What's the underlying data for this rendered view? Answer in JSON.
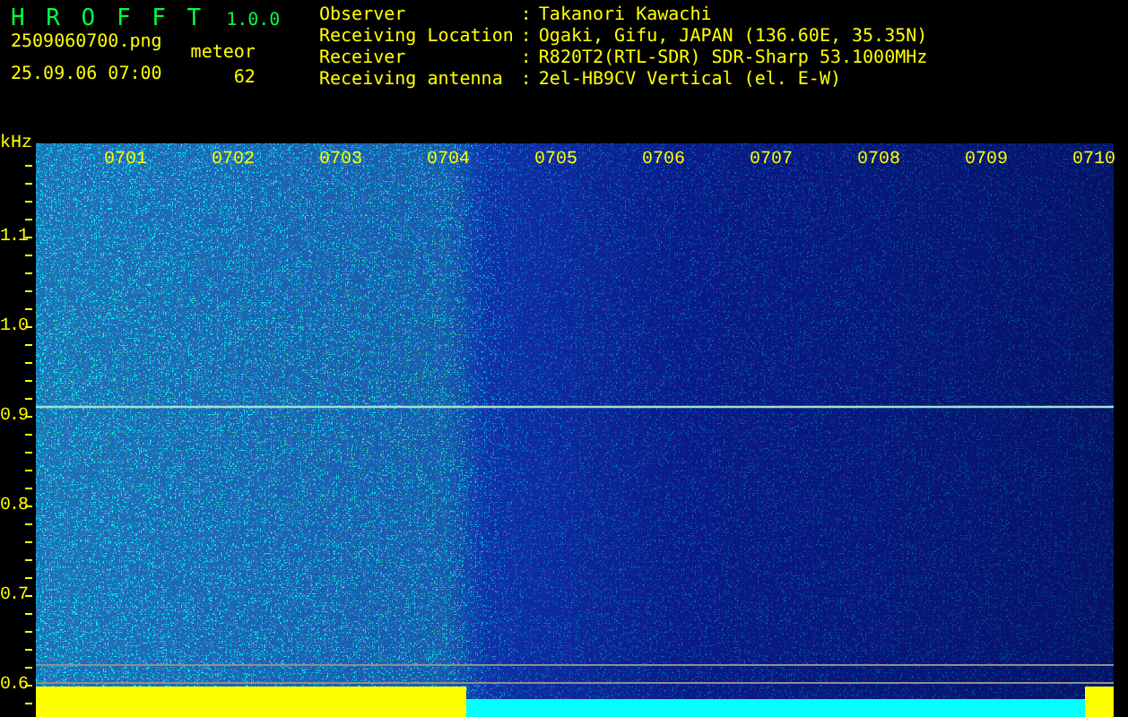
{
  "header": {
    "title": "H R O F F T",
    "version": "1.0.0",
    "filename": "2509060700.png",
    "datetime": "25.09.06 07:00",
    "count_label": "meteor",
    "count": "62"
  },
  "info": [
    {
      "label": "Observer",
      "separator": ":",
      "value": "Takanori Kawachi"
    },
    {
      "label": "Receiving Location",
      "separator": ":",
      "value": "Ogaki, Gifu, JAPAN (136.60E, 35.35N)"
    },
    {
      "label": "Receiver",
      "separator": ":",
      "value": "R820T2(RTL-SDR) SDR-Sharp 53.1000MHz"
    },
    {
      "label": "Receiving antenna",
      "separator": ":",
      "value": "2el-HB9CV Vertical (el. E-W)"
    }
  ],
  "plot": {
    "unit": "kHz",
    "y_ticks": [
      "1.1",
      "1.0",
      "0.9",
      "0.8",
      "0.7",
      "0.6"
    ],
    "time_labels": [
      "0701",
      "0702",
      "0703",
      "0704",
      "0705",
      "0706",
      "0707",
      "0708",
      "0709",
      "0710"
    ]
  }
}
